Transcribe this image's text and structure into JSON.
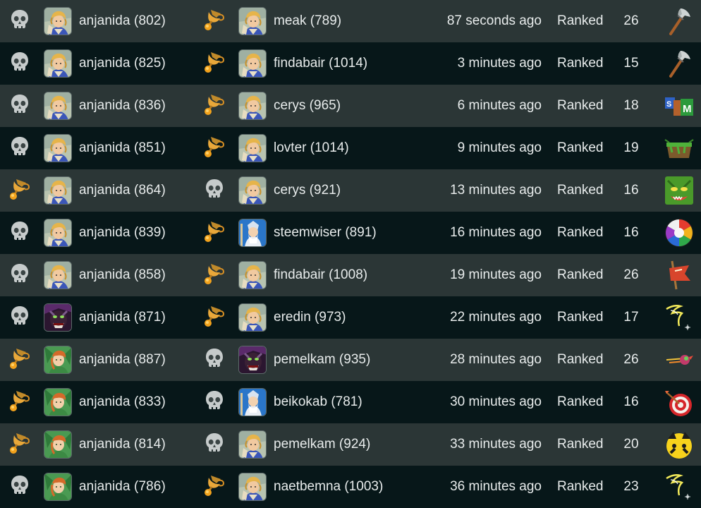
{
  "rows": [
    {
      "p1_result": "loss",
      "p1_avatar": "blonde-hero",
      "p1": "anjanida (802)",
      "p2_result": "win",
      "p2_avatar": "blonde-hero",
      "p2": "meak (789)",
      "time": "87 seconds ago",
      "mode": "Ranked",
      "mana": "26",
      "ruleset_icon": "axe-icon"
    },
    {
      "p1_result": "loss",
      "p1_avatar": "blonde-hero",
      "p1": "anjanida (825)",
      "p2_result": "win",
      "p2_avatar": "blonde-hero",
      "p2": "findabair (1014)",
      "time": "3 minutes ago",
      "mode": "Ranked",
      "mana": "15",
      "ruleset_icon": "axe-icon"
    },
    {
      "p1_result": "loss",
      "p1_avatar": "blonde-hero",
      "p1": "anjanida (836)",
      "p2_result": "win",
      "p2_avatar": "blonde-hero",
      "p2": "cerys (965)",
      "time": "6 minutes ago",
      "mode": "Ranked",
      "mana": "18",
      "ruleset_icon": "sm-crates-icon"
    },
    {
      "p1_result": "loss",
      "p1_avatar": "blonde-hero",
      "p1": "anjanida (851)",
      "p2_result": "win",
      "p2_avatar": "blonde-hero",
      "p2": "lovter (1014)",
      "time": "9 minutes ago",
      "mode": "Ranked",
      "mana": "19",
      "ruleset_icon": "earth-block-icon"
    },
    {
      "p1_result": "win",
      "p1_avatar": "blonde-hero",
      "p1": "anjanida (864)",
      "p2_result": "loss",
      "p2_avatar": "blonde-hero",
      "p2": "cerys (921)",
      "time": "13 minutes ago",
      "mode": "Ranked",
      "mana": "16",
      "ruleset_icon": "goblin-face-icon"
    },
    {
      "p1_result": "loss",
      "p1_avatar": "blonde-hero",
      "p1": "anjanida (839)",
      "p2_result": "win",
      "p2_avatar": "wizard",
      "p2": "steemwiser (891)",
      "time": "16 minutes ago",
      "mode": "Ranked",
      "mana": "16",
      "ruleset_icon": "color-wheel-icon"
    },
    {
      "p1_result": "loss",
      "p1_avatar": "blonde-hero",
      "p1": "anjanida (858)",
      "p2_result": "win",
      "p2_avatar": "blonde-hero",
      "p2": "findabair (1008)",
      "time": "19 minutes ago",
      "mode": "Ranked",
      "mana": "26",
      "ruleset_icon": "red-banner-icon"
    },
    {
      "p1_result": "loss",
      "p1_avatar": "dark-demon",
      "p1": "anjanida (871)",
      "p2_result": "win",
      "p2_avatar": "blonde-hero",
      "p2": "eredin (973)",
      "time": "22 minutes ago",
      "mode": "Ranked",
      "mana": "17",
      "ruleset_icon": "lightning-icon"
    },
    {
      "p1_result": "win",
      "p1_avatar": "green-elf",
      "p1": "anjanida (887)",
      "p2_result": "loss",
      "p2_avatar": "dark-demon",
      "p2": "pemelkam (935)",
      "time": "28 minutes ago",
      "mode": "Ranked",
      "mana": "26",
      "ruleset_icon": "comet-icon"
    },
    {
      "p1_result": "win",
      "p1_avatar": "green-elf",
      "p1": "anjanida (833)",
      "p2_result": "loss",
      "p2_avatar": "wizard",
      "p2": "beikokab (781)",
      "time": "30 minutes ago",
      "mode": "Ranked",
      "mana": "16",
      "ruleset_icon": "target-icon"
    },
    {
      "p1_result": "win",
      "p1_avatar": "green-elf",
      "p1": "anjanida (814)",
      "p2_result": "loss",
      "p2_avatar": "blonde-hero",
      "p2": "pemelkam (924)",
      "time": "33 minutes ago",
      "mode": "Ranked",
      "mana": "20",
      "ruleset_icon": "yellow-face-icon"
    },
    {
      "p1_result": "loss",
      "p1_avatar": "green-elf",
      "p1": "anjanida (786)",
      "p2_result": "win",
      "p2_avatar": "blonde-hero",
      "p2": "naetbemna (1003)",
      "time": "36 minutes ago",
      "mode": "Ranked",
      "mana": "23",
      "ruleset_icon": "lightning-icon"
    }
  ]
}
